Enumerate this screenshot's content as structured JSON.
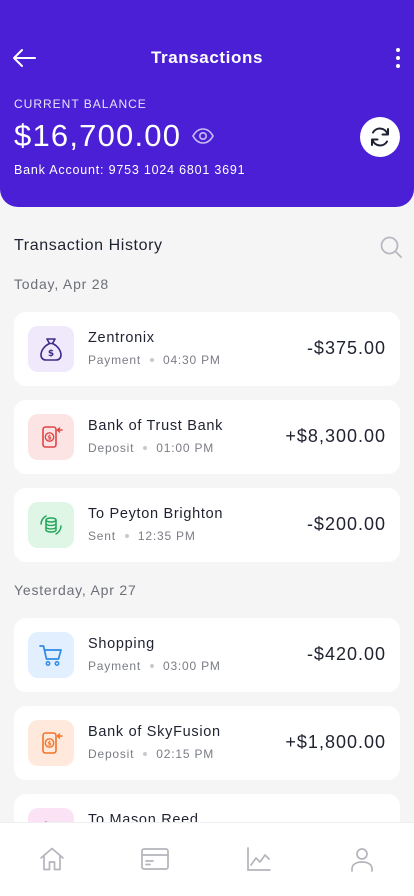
{
  "header": {
    "title": "Transactions",
    "balance_label": "CURRENT BALANCE",
    "balance": "$16,700.00",
    "bank_account": "Bank Account: 9753 1024 6801 3691",
    "bg_color": "#4a1fd6",
    "icons": [
      "arrow-left-icon",
      "more-vertical-icon",
      "eye-icon",
      "refresh-icon"
    ]
  },
  "history": {
    "title": "Transaction History",
    "groups": [
      {
        "label": "Today, Apr 28",
        "items": [
          {
            "name": "Zentronix",
            "type": "Payment",
            "time": "04:30 PM",
            "amount": "-$375.00",
            "icon": "money-bag-icon",
            "icon_bg": "#efe9fb",
            "icon_color": "#3d2a8a"
          },
          {
            "name": "Bank of Trust Bank",
            "type": "Deposit",
            "time": "01:00 PM",
            "amount": "+$8,300.00",
            "icon": "phone-deposit-icon",
            "icon_bg": "#fde4e4",
            "icon_color": "#e04545"
          },
          {
            "name": "To Peyton Brighton",
            "type": "Sent",
            "time": "12:35 PM",
            "amount": "-$200.00",
            "icon": "coin-transfer-icon",
            "icon_bg": "#dff5e6",
            "icon_color": "#22a559"
          }
        ]
      },
      {
        "label": "Yesterday, Apr 27",
        "items": [
          {
            "name": "Shopping",
            "type": "Payment",
            "time": "03:00 PM",
            "amount": "-$420.00",
            "icon": "cart-icon",
            "icon_bg": "#e1efff",
            "icon_color": "#2f8ae6"
          },
          {
            "name": "Bank of SkyFusion",
            "type": "Deposit",
            "time": "02:15 PM",
            "amount": "+$1,800.00",
            "icon": "phone-deposit-icon",
            "icon_bg": "#ffe9dc",
            "icon_color": "#f2732a"
          },
          {
            "name": "To Mason Reed",
            "type": "",
            "time": "",
            "amount": "",
            "icon": "coin-transfer-icon",
            "icon_bg": "#fbe3f5",
            "icon_color": "#c23aa6"
          }
        ]
      }
    ]
  },
  "nav": {
    "items": [
      "home-icon",
      "card-icon",
      "chart-icon",
      "user-icon"
    ]
  }
}
